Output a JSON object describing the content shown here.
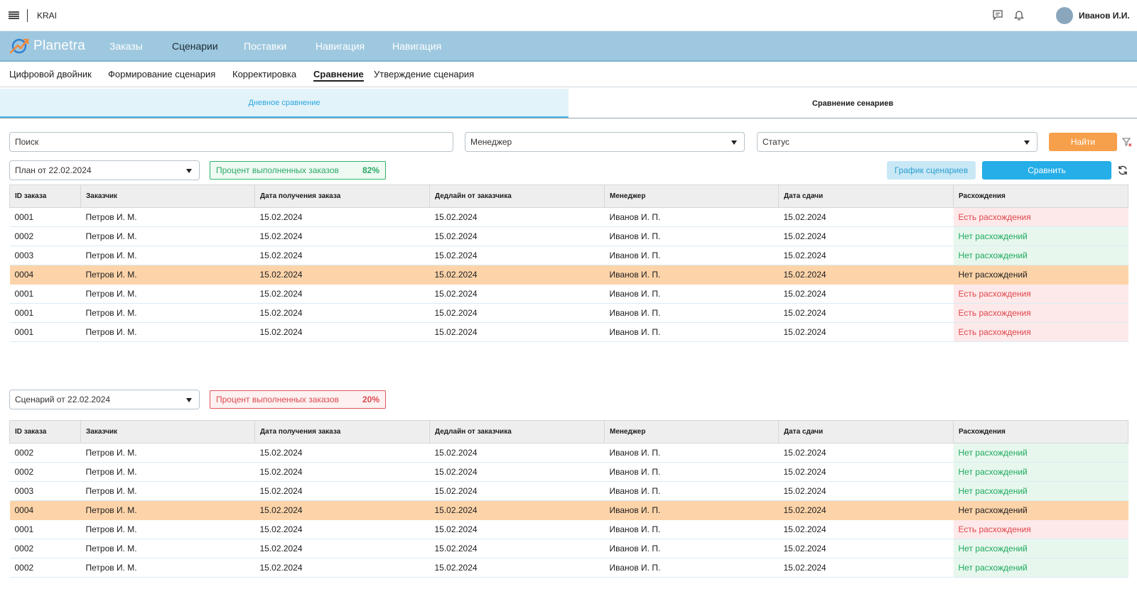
{
  "topbar": {
    "app_name": "KRAI",
    "user_name": "Иванов И.И."
  },
  "nav": {
    "logo_text": "Planetra",
    "items": [
      {
        "label": "Заказы",
        "active": false
      },
      {
        "label": "Сценарии",
        "active": true
      },
      {
        "label": "Поставки",
        "active": false
      },
      {
        "label": "Навигация",
        "active": false
      },
      {
        "label": "Навигация",
        "active": false
      }
    ]
  },
  "subnav": {
    "items": [
      {
        "label": "Цифровой двойник"
      },
      {
        "label": "Формирование сценария"
      },
      {
        "label": "Корректировка"
      },
      {
        "label": "Сравнение"
      },
      {
        "label": "Утверждение сценария"
      }
    ]
  },
  "tabs": {
    "daily": "Дневное сравнение",
    "scenarios": "Сравнение сенариев"
  },
  "filters": {
    "search_placeholder": "Поиск",
    "manager_placeholder": "Менеджер",
    "status_placeholder": "Статус",
    "find_label": "Найти"
  },
  "plan": {
    "select_value": "План от 22.02.2024",
    "kpi_label": "Процент выполненных заказов",
    "kpi_value": "82%"
  },
  "scenario": {
    "select_value": "Сценарий от 22.02.2024",
    "kpi_label": "Процент выполненных заказов",
    "kpi_value": "20%"
  },
  "actions": {
    "chart_label": "График сценариев",
    "compare_label": "Сравнить"
  },
  "table": {
    "columns": [
      "ID заказа",
      "Заказчик",
      "Дата получения заказа",
      "Дедлайн от заказчика",
      "Менеджер",
      "Дата сдачи",
      "Расхождения"
    ]
  },
  "plan_rows": [
    {
      "id": "0001",
      "customer": "Петров И. М.",
      "received": "15.02.2024",
      "deadline": "15.02.2024",
      "manager": "Иванов И. П.",
      "delivery": "15.02.2024",
      "discrepancy": "Есть расхождения",
      "status": "bad",
      "highlight": false
    },
    {
      "id": "0002",
      "customer": "Петров И. М.",
      "received": "15.02.2024",
      "deadline": "15.02.2024",
      "manager": "Иванов И. П.",
      "delivery": "15.02.2024",
      "discrepancy": "Нет расхождений",
      "status": "good",
      "highlight": false
    },
    {
      "id": "0003",
      "customer": "Петров И. М.",
      "received": "15.02.2024",
      "deadline": "15.02.2024",
      "manager": "Иванов И. П.",
      "delivery": "15.02.2024",
      "discrepancy": "Нет расхождений",
      "status": "good",
      "highlight": false
    },
    {
      "id": "0004",
      "customer": "Петров И. М.",
      "received": "15.02.2024",
      "deadline": "15.02.2024",
      "manager": "Иванов И. П.",
      "delivery": "15.02.2024",
      "discrepancy": "Нет расхождений",
      "status": "good",
      "highlight": true
    },
    {
      "id": "0001",
      "customer": "Петров И. М.",
      "received": "15.02.2024",
      "deadline": "15.02.2024",
      "manager": "Иванов И. П.",
      "delivery": "15.02.2024",
      "discrepancy": "Есть расхождения",
      "status": "bad",
      "highlight": false
    },
    {
      "id": "0001",
      "customer": "Петров И. М.",
      "received": "15.02.2024",
      "deadline": "15.02.2024",
      "manager": "Иванов И. П.",
      "delivery": "15.02.2024",
      "discrepancy": "Есть расхождения",
      "status": "bad",
      "highlight": false
    },
    {
      "id": "0001",
      "customer": "Петров И. М.",
      "received": "15.02.2024",
      "deadline": "15.02.2024",
      "manager": "Иванов И. П.",
      "delivery": "15.02.2024",
      "discrepancy": "Есть расхождения",
      "status": "bad",
      "highlight": false
    }
  ],
  "scenario_rows": [
    {
      "id": "0002",
      "customer": "Петров И. М.",
      "received": "15.02.2024",
      "deadline": "15.02.2024",
      "manager": "Иванов И. П.",
      "delivery": "15.02.2024",
      "discrepancy": "Нет расхождений",
      "status": "good",
      "highlight": false
    },
    {
      "id": "0002",
      "customer": "Петров И. М.",
      "received": "15.02.2024",
      "deadline": "15.02.2024",
      "manager": "Иванов И. П.",
      "delivery": "15.02.2024",
      "discrepancy": "Нет расхождений",
      "status": "good",
      "highlight": false
    },
    {
      "id": "0003",
      "customer": "Петров И. М.",
      "received": "15.02.2024",
      "deadline": "15.02.2024",
      "manager": "Иванов И. П.",
      "delivery": "15.02.2024",
      "discrepancy": "Нет расхождений",
      "status": "good",
      "highlight": false
    },
    {
      "id": "0004",
      "customer": "Петров И. М.",
      "received": "15.02.2024",
      "deadline": "15.02.2024",
      "manager": "Иванов И. П.",
      "delivery": "15.02.2024",
      "discrepancy": "Нет расхождений",
      "status": "good",
      "highlight": true
    },
    {
      "id": "0001",
      "customer": "Петров И. М.",
      "received": "15.02.2024",
      "deadline": "15.02.2024",
      "manager": "Иванов И. П.",
      "delivery": "15.02.2024",
      "discrepancy": "Есть расхождения",
      "status": "bad",
      "highlight": false
    },
    {
      "id": "0002",
      "customer": "Петров И. М.",
      "received": "15.02.2024",
      "deadline": "15.02.2024",
      "manager": "Иванов И. П.",
      "delivery": "15.02.2024",
      "discrepancy": "Нет расхождений",
      "status": "good",
      "highlight": false
    },
    {
      "id": "0002",
      "customer": "Петров И. М.",
      "received": "15.02.2024",
      "deadline": "15.02.2024",
      "manager": "Иванов И. П.",
      "delivery": "15.02.2024",
      "discrepancy": "Нет расхождений",
      "status": "good",
      "highlight": false
    }
  ],
  "colors": {
    "nav_bg": "#9ec8df",
    "accent_blue": "#25aee7",
    "accent_orange": "#f7a04b",
    "highlight_row": "#fdd4a9",
    "status_bad": "#e0474c",
    "status_good": "#1daa5d"
  },
  "icons": [
    "menu-icon",
    "chat-icon",
    "bell-icon",
    "logo-icon",
    "chevron-down-icon",
    "clear-filter-icon",
    "refresh-icon"
  ]
}
